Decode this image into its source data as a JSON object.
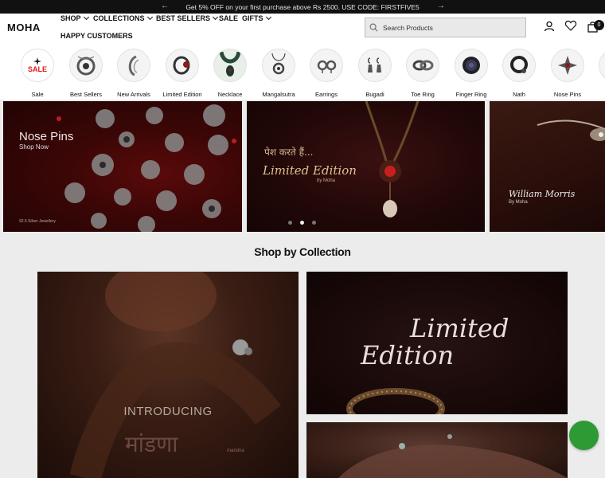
{
  "announcement": {
    "text": "Get 5% OFF on your first purchase above Rs 2500. USE CODE: FIRSTFIVE5",
    "prev": "←",
    "next": "→"
  },
  "header": {
    "logo": "MOHA",
    "nav": [
      {
        "label": "SHOP"
      },
      {
        "label": "COLLECTIONS"
      },
      {
        "label": "BEST SELLERS"
      },
      {
        "label": "SALE"
      },
      {
        "label": "GIFTS"
      },
      {
        "label": "HAPPY CUSTOMERS"
      }
    ],
    "search_placeholder": "Search Products",
    "cart_count": "0"
  },
  "categories": [
    {
      "label": "Sale",
      "badge": "SALE"
    },
    {
      "label": "Best Sellers"
    },
    {
      "label": "New Arrivals"
    },
    {
      "label": "Limited Edition"
    },
    {
      "label": "Necklace"
    },
    {
      "label": "Mangalsutra"
    },
    {
      "label": "Earrings"
    },
    {
      "label": "Bugadi"
    },
    {
      "label": "Toe Ring"
    },
    {
      "label": "Finger Ring"
    },
    {
      "label": "Nath"
    },
    {
      "label": "Nose Pins"
    }
  ],
  "hero": {
    "slide1": {
      "title": "Nose Pins",
      "sub": "Shop Now",
      "foot": "92.5 Silver Jewellery"
    },
    "slide2": {
      "hindi": "पेश करते हैं...",
      "title": "Limited Edition",
      "by": "by Moha"
    },
    "slide3": {
      "title": "William Morris",
      "by": "By Moha"
    }
  },
  "section": {
    "title": "Shop by Collection",
    "tile1": {
      "intro": "INTRODUCING",
      "hindi": "मांडणा",
      "brand": "mandna"
    },
    "tile2": {
      "line1": "Limited",
      "line2": "Edition"
    }
  },
  "colors": {
    "accent": "#111111",
    "sale_red": "#e01818",
    "whatsapp": "#2e9a34"
  }
}
